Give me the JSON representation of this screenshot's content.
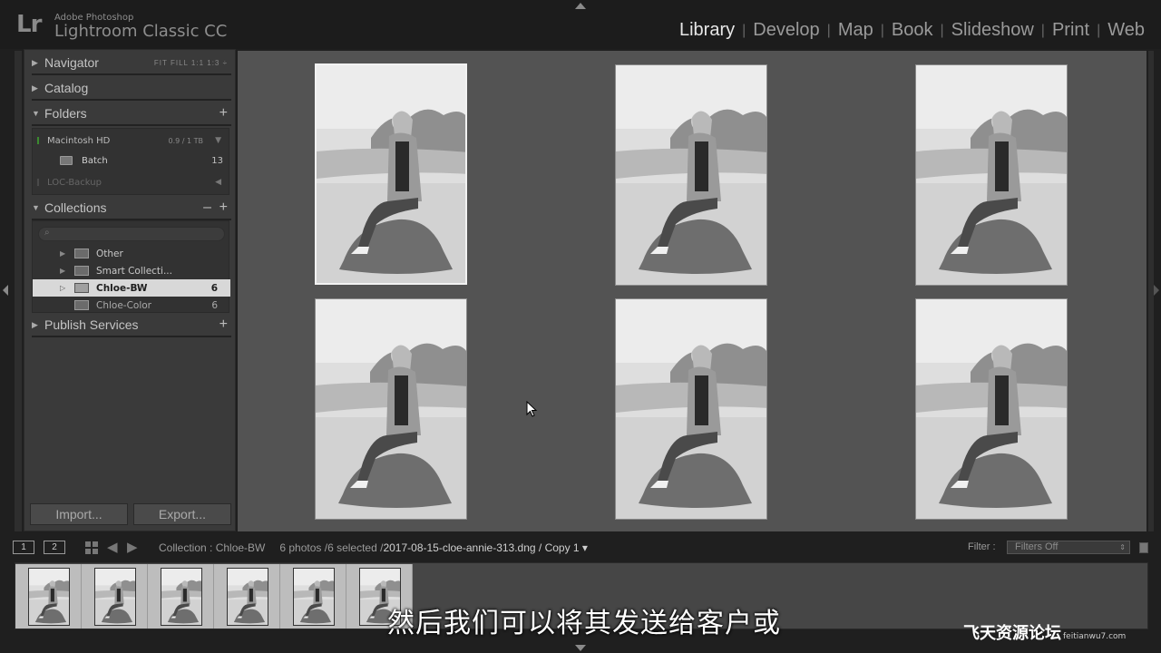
{
  "app": {
    "logo": "Lr",
    "subtitle": "Adobe Photoshop",
    "title": "Lightroom Classic CC"
  },
  "modules": [
    {
      "label": "Library",
      "active": true
    },
    {
      "label": "Develop",
      "active": false
    },
    {
      "label": "Map",
      "active": false
    },
    {
      "label": "Book",
      "active": false
    },
    {
      "label": "Slideshow",
      "active": false
    },
    {
      "label": "Print",
      "active": false
    },
    {
      "label": "Web",
      "active": false
    }
  ],
  "left_panel": {
    "navigator": {
      "label": "Navigator",
      "options": "FIT  FILL  1:1  1:3 ÷"
    },
    "catalog": {
      "label": "Catalog"
    },
    "folders": {
      "label": "Folders",
      "volumes": [
        {
          "name": "Macintosh HD",
          "capacity": "0.9 / 1 TB"
        },
        {
          "name": "LOC-Backup",
          "capacity": ""
        }
      ],
      "items": [
        {
          "name": "Batch",
          "count": "13"
        }
      ]
    },
    "collections": {
      "label": "Collections",
      "items": [
        {
          "name": "Other",
          "count": ""
        },
        {
          "name": "Smart Collecti...",
          "count": ""
        },
        {
          "name": "Chloe-BW",
          "count": "6"
        },
        {
          "name": "Chloe-Color",
          "count": "6"
        }
      ]
    },
    "publish": {
      "label": "Publish Services"
    },
    "import_label": "Import...",
    "export_label": "Export..."
  },
  "filmstrip_bar": {
    "monitor1": "1",
    "monitor2": "2",
    "source": "Collection : Chloe-BW",
    "count": "6 photos /6 selected /",
    "filename": "2017-08-15-cloe-annie-313.dng / Copy 1 ▾",
    "filter_label": "Filter :",
    "filter_value": "Filters Off"
  },
  "overlay": {
    "subtitle": "然后我们可以将其发送给客户或",
    "watermark": "飞天资源论坛",
    "watermark_url": "feitianwu7.com"
  },
  "colors": {
    "background": "#1f1f1f",
    "panel": "#3a3a3a",
    "grid": "#535353",
    "selected_row": "#d8d8d8",
    "active_module": "#e8e8e8"
  }
}
